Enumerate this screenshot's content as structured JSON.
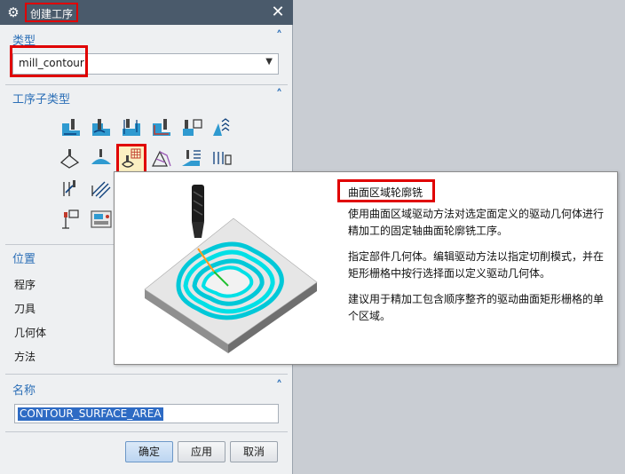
{
  "window": {
    "title": "创建工序",
    "close_symbol": "✕",
    "gear_symbol": "⚙"
  },
  "sections": {
    "type": {
      "label": "类型",
      "value": "mill_contour"
    },
    "subtype": {
      "label": "工序子类型",
      "icons": [
        "cavity-mill-icon",
        "adaptive-milling-icon",
        "plunge-milling-icon",
        "corner-rough-icon",
        "rest-milling-icon",
        "zlevel-profile-icon",
        "zlevel-corner-icon",
        "fixed-contour-icon",
        "contour-area-icon",
        "contour-surface-area-icon",
        "streamline-icon",
        "contour-area-non-steep-icon",
        "contour-area-dir-steep-icon",
        "flowcut-single-icon",
        "flowcut-multiple-icon",
        "flowcut-ref-tool-icon",
        "flowcut-smooth-icon",
        "solid-profile-3d-icon",
        "profile-3d-icon",
        "contour-text-icon",
        "mill-control-icon",
        "mill-user-icon"
      ],
      "selected_icon": "contour-surface-area-icon"
    },
    "location": {
      "label": "位置",
      "fields": [
        "程序",
        "刀具",
        "几何体",
        "方法"
      ]
    },
    "name": {
      "label": "名称",
      "value": "CONTOUR_SURFACE_AREA"
    }
  },
  "buttons": {
    "ok": "确定",
    "apply": "应用",
    "cancel": "取消"
  },
  "tooltip": {
    "title": "曲面区域轮廓铣",
    "paragraphs": [
      "使用曲面区域驱动方法对选定面定义的驱动几何体进行精加工的固定轴曲面轮廓铣工序。",
      "指定部件几何体。编辑驱动方法以指定切削模式，并在矩形栅格中按行选择面以定义驱动几何体。",
      "建议用于精加工包含顺序整齐的驱动曲面矩形栅格的单个区域。"
    ]
  },
  "colors": {
    "accent": "#2c6fb7",
    "titlebar": "#4a5a6b",
    "highlight": "#e00000",
    "toolpath": "#00e0e0"
  }
}
